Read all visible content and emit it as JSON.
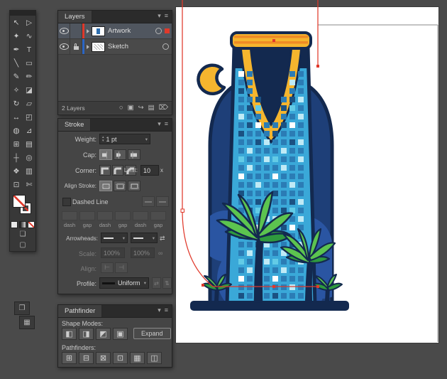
{
  "icons": {
    "collapse": "▾",
    "menu": "≡",
    "dropdown": "▾",
    "up": "▴",
    "down": "▾",
    "swap": "⇄",
    "link": "∞",
    "align_left": "⊢",
    "align_right": "⊣",
    "flip_horizontal": "⇄",
    "flip_vertical": "⇅",
    "dock1": "❐",
    "dock2": "▦"
  },
  "toolbar": {
    "tools": [
      {
        "name": "selection",
        "glyph": "↖"
      },
      {
        "name": "direct-selection",
        "glyph": "▷"
      },
      {
        "name": "magic-wand",
        "glyph": "✦"
      },
      {
        "name": "lasso",
        "glyph": "∿"
      },
      {
        "name": "pen",
        "glyph": "✒"
      },
      {
        "name": "type",
        "glyph": "T"
      },
      {
        "name": "line-segment",
        "glyph": "╲"
      },
      {
        "name": "rectangle",
        "glyph": "▭"
      },
      {
        "name": "paintbrush",
        "glyph": "✎"
      },
      {
        "name": "pencil",
        "glyph": "✏"
      },
      {
        "name": "shaper",
        "glyph": "✧"
      },
      {
        "name": "eraser",
        "glyph": "◪"
      },
      {
        "name": "rotate",
        "glyph": "↻"
      },
      {
        "name": "scale",
        "glyph": "▱"
      },
      {
        "name": "width",
        "glyph": "↔"
      },
      {
        "name": "free-transform",
        "glyph": "◰"
      },
      {
        "name": "shape-builder",
        "glyph": "◍"
      },
      {
        "name": "perspective-grid",
        "glyph": "⊿"
      },
      {
        "name": "mesh",
        "glyph": "⊞"
      },
      {
        "name": "gradient",
        "glyph": "▤"
      },
      {
        "name": "eyedropper",
        "glyph": "┼"
      },
      {
        "name": "blend",
        "glyph": "◎"
      },
      {
        "name": "symbol-sprayer",
        "glyph": "❖"
      },
      {
        "name": "column-graph",
        "glyph": "▥"
      },
      {
        "name": "artboard",
        "glyph": "⊡"
      },
      {
        "name": "slice",
        "glyph": "✄"
      }
    ]
  },
  "layers_panel": {
    "title": "Layers",
    "status": "2 Layers",
    "layers": [
      {
        "name": "Artwork",
        "color": "#e0392b",
        "visible": true,
        "locked": false,
        "selected": true
      },
      {
        "name": "Sketch",
        "color": "#2b66c4",
        "visible": true,
        "locked": true,
        "selected": false
      }
    ],
    "bottom_icons": [
      {
        "name": "locate-object",
        "glyph": "○"
      },
      {
        "name": "clipping-mask",
        "glyph": "▣"
      },
      {
        "name": "new-sublayer",
        "glyph": "↪"
      },
      {
        "name": "new-layer",
        "glyph": "▤"
      },
      {
        "name": "delete-layer",
        "glyph": "⌦"
      }
    ]
  },
  "stroke_panel": {
    "title": "Stroke",
    "weight_label": "Weight:",
    "weight_value": "1 pt",
    "cap_label": "Cap:",
    "corner_label": "Corner:",
    "limit_label": "Limit:",
    "limit_value": "10",
    "limit_suffix": "x",
    "align_stroke_label": "Align Stroke:",
    "dashed_line_label": "Dashed Line",
    "dash_labels": [
      "dash",
      "gap",
      "dash",
      "gap",
      "dash",
      "gap"
    ],
    "arrowheads_label": "Arrowheads:",
    "scale_label": "Scale:",
    "scale_left": "100%",
    "scale_right": "100%",
    "align_label": "Align:",
    "profile_label": "Profile:",
    "profile_value": "Uniform"
  },
  "pathfinder_panel": {
    "title": "Pathfinder",
    "shape_modes_label": "Shape Modes:",
    "expand_label": "Expand",
    "pathfinders_label": "Pathfinders:",
    "shape_modes": [
      {
        "name": "unite",
        "glyph": "◧"
      },
      {
        "name": "minus-front",
        "glyph": "◨"
      },
      {
        "name": "intersect",
        "glyph": "◩"
      },
      {
        "name": "exclude",
        "glyph": "▣"
      }
    ],
    "pathfinders": [
      {
        "name": "divide",
        "glyph": "⊞"
      },
      {
        "name": "trim",
        "glyph": "⊟"
      },
      {
        "name": "merge",
        "glyph": "⊠"
      },
      {
        "name": "crop",
        "glyph": "⊡"
      },
      {
        "name": "outline",
        "glyph": "▦"
      },
      {
        "name": "minus-back",
        "glyph": "◫"
      }
    ]
  },
  "artwork": {
    "navy": "#13294f",
    "arch": "#1e3f78",
    "arch_light": "#2a55a2",
    "tower": "#3aa8d8",
    "window": "#2b7cb5",
    "window_bright": "#ffffff",
    "window_pale": "#bfeaf6",
    "window_mid": "#63cbe6",
    "window_dark": "#1b5182",
    "gold": "#f5b52e",
    "orange": "#ee8b25",
    "palm_light": "#5cc44f",
    "palm_dark": "#2f9a3e",
    "selection_red": "#e0392b"
  }
}
